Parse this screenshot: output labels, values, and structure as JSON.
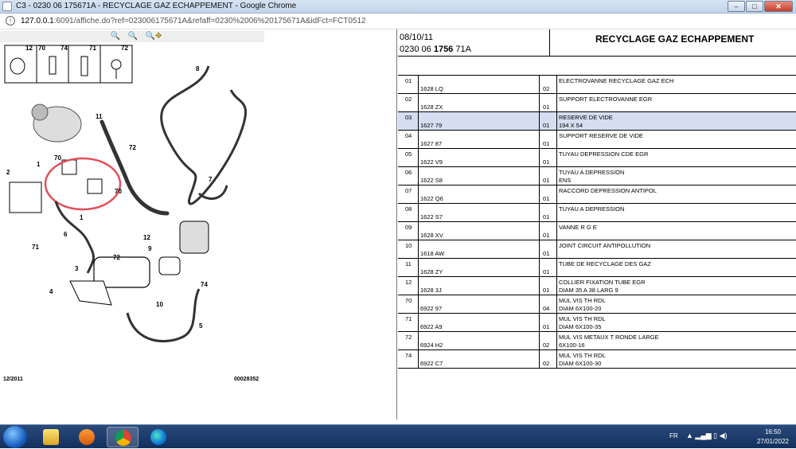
{
  "window": {
    "title": "C3 - 0230 06 175671A - RECYCLAGE GAZ ECHAPPEMENT - Google Chrome",
    "minimize_icon": "minimize-icon",
    "maximize_icon": "maximize-icon",
    "close_icon": "close-icon"
  },
  "browser": {
    "url_host": "127.0.0.1",
    "url_rest": ":6091/affiche.do?ref=023006175671A&refaff=0230%2006%20175671A&idFct=FCT0512"
  },
  "diagram": {
    "date": "12/2011",
    "ref": "00028352",
    "labels": [
      "12",
      "70",
      "74",
      "71",
      "72",
      "8",
      "11",
      "72",
      "1",
      "70",
      "2",
      "70",
      "7",
      "1",
      "6",
      "12",
      "9",
      "71",
      "3",
      "72",
      "74",
      "4",
      "10",
      "5"
    ],
    "highlight_color": "#e0505a"
  },
  "header": {
    "date": "08/10/11",
    "code_prefix": "0230 06 ",
    "code_bold": "1756",
    "code_suffix": " 71A",
    "title": "RECYCLAGE GAZ ECHAPPEMENT"
  },
  "parts": [
    {
      "num": "01",
      "ref": "1628 LQ",
      "qty": "02",
      "desc": "ELECTROVANNE RECYCLAGE GAZ ECH",
      "desc2": ""
    },
    {
      "num": "02",
      "ref": "1628 ZX",
      "qty": "01",
      "desc": "SUPPORT ELECTROVANNE EGR",
      "desc2": ""
    },
    {
      "num": "03",
      "ref": "1627 79",
      "qty": "01",
      "desc": "RESERVE DE VIDE",
      "desc2": "194 X 54"
    },
    {
      "num": "04",
      "ref": "1627 87",
      "qty": "01",
      "desc": "SUPPORT RESERVE DE VIDE",
      "desc2": ""
    },
    {
      "num": "05",
      "ref": "1622 V9",
      "qty": "01",
      "desc": "TUYAU DEPRESSION CDE EGR",
      "desc2": ""
    },
    {
      "num": "06",
      "ref": "1622 S8",
      "qty": "01",
      "desc": "TUYAU A DEPRESSION",
      "desc2": "ENS"
    },
    {
      "num": "07",
      "ref": "1622 Q6",
      "qty": "01",
      "desc": "RACCORD DEPRESSION ANTIPOL",
      "desc2": ""
    },
    {
      "num": "08",
      "ref": "1622 S7",
      "qty": "01",
      "desc": "TUYAU A DEPRESSION",
      "desc2": ""
    },
    {
      "num": "09",
      "ref": "1628 XV",
      "qty": "01",
      "desc": "VANNE R G E",
      "desc2": ""
    },
    {
      "num": "10",
      "ref": "1618 AW",
      "qty": "01",
      "desc": "JOINT CIRCUIT ANTIPOLLUTION",
      "desc2": ""
    },
    {
      "num": "11",
      "ref": "1628 ZY",
      "qty": "01",
      "desc": "TUBE DE RECYCLAGE DES GAZ",
      "desc2": ""
    },
    {
      "num": "12",
      "ref": "1628 3J",
      "qty": "01",
      "desc": "COLLIER FIXATION TUBE EGR",
      "desc2": "DIAM 35 A 38 LARG 9"
    },
    {
      "num": "70",
      "ref": "6922 97",
      "qty": "04",
      "desc": "MUL VIS TH RDL",
      "desc2": "DIAM 6X100-20"
    },
    {
      "num": "71",
      "ref": "6922 A9",
      "qty": "01",
      "desc": "MUL VIS TH RDL",
      "desc2": "DIAM 6X100-35"
    },
    {
      "num": "72",
      "ref": "6924 H2",
      "qty": "02",
      "desc": "MUL VIS METAUX T RONDE LARGE",
      "desc2": "6X100-16"
    },
    {
      "num": "74",
      "ref": "6922 C7",
      "qty": "02",
      "desc": "MUL VIS TH RDL",
      "desc2": "DIAM 6X100-30"
    }
  ],
  "highlight_row_color": "#d4def0",
  "taskbar": {
    "lang": "FR",
    "tray_icons": "▲  ▂▄▆  ▯  ◀)",
    "time": "16:50",
    "date": "27/01/2022",
    "apps": [
      "start-orb-icon",
      "file-explorer-icon",
      "media-player-icon",
      "chrome-icon",
      "edge-icon"
    ]
  }
}
